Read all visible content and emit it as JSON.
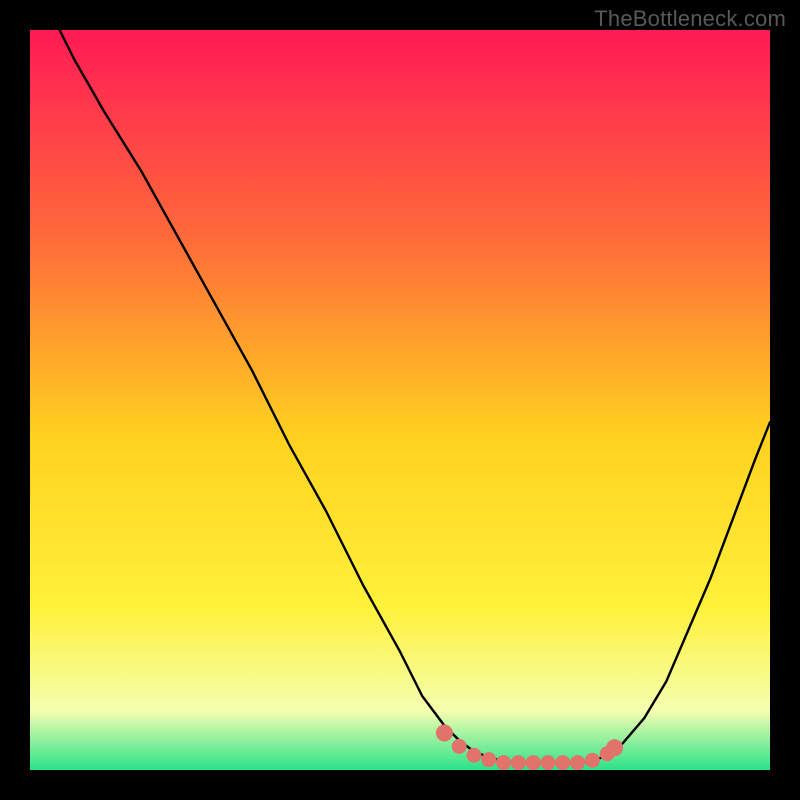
{
  "watermark": "TheBottleneck.com",
  "colors": {
    "gradient_top": "#ff1a55",
    "gradient_mid1": "#ff6a3a",
    "gradient_mid2": "#ffd21f",
    "gradient_mid3": "#fff13a",
    "gradient_mid4": "#f4ffb0",
    "gradient_bottom": "#2be28a",
    "curve": "#000000",
    "dot": "#e2736b",
    "frame": "#000000"
  },
  "chart_data": {
    "type": "line",
    "title": "",
    "xlabel": "",
    "ylabel": "",
    "xlim": [
      0,
      100
    ],
    "ylim": [
      0,
      100
    ],
    "series": [
      {
        "name": "bottleneck-curve",
        "x": [
          4,
          6,
          10,
          15,
          20,
          25,
          30,
          35,
          40,
          45,
          50,
          53,
          56,
          58,
          60,
          62,
          64,
          66,
          68,
          70,
          72,
          74,
          76,
          78,
          80,
          83,
          86,
          89,
          92,
          95,
          98,
          100
        ],
        "y": [
          100,
          96,
          89,
          81,
          72,
          63,
          54,
          44,
          35,
          25,
          16,
          10,
          6,
          4,
          2.5,
          1.7,
          1.2,
          1.0,
          1.0,
          1.0,
          1.0,
          1.0,
          1.2,
          2,
          3.5,
          7,
          12,
          19,
          26,
          34,
          42,
          47
        ]
      }
    ],
    "highlight_points": {
      "name": "selected-range",
      "x": [
        56,
        58,
        60,
        62,
        64,
        66,
        68,
        70,
        72,
        74,
        76,
        78,
        79
      ],
      "y": [
        5.0,
        3.2,
        2.0,
        1.4,
        1.0,
        1.0,
        1.0,
        1.0,
        1.0,
        1.0,
        1.3,
        2.2,
        3.0
      ]
    }
  }
}
